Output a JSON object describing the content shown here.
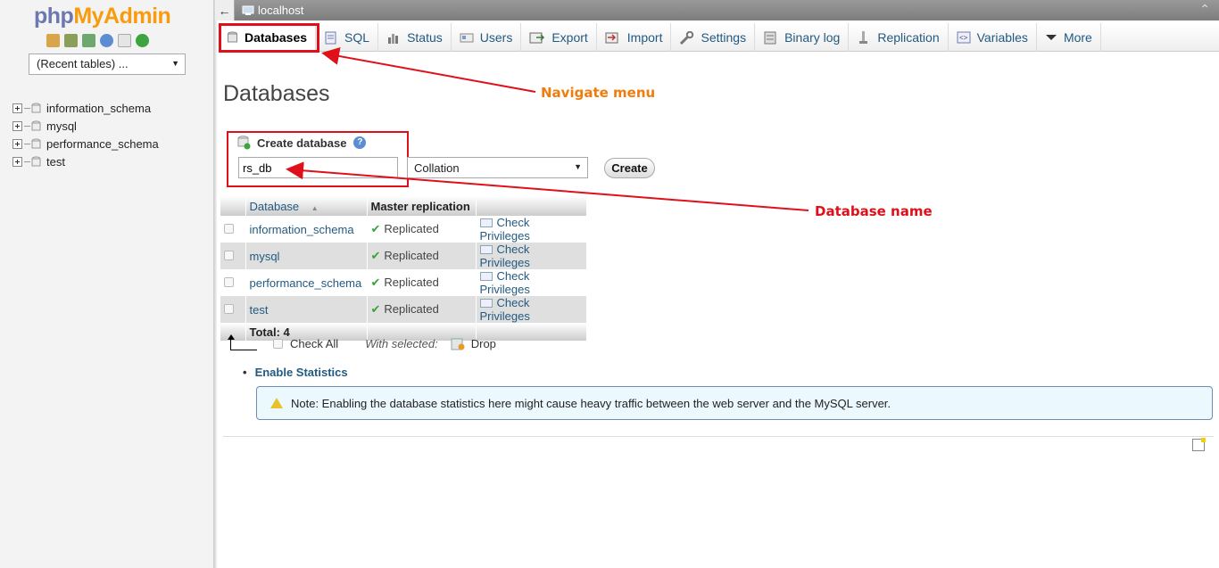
{
  "logo": {
    "php": "php",
    "myadmin": "MyAdmin"
  },
  "sidebar": {
    "recent_tables": "(Recent tables) ...",
    "databases": [
      "information_schema",
      "mysql",
      "performance_schema",
      "test"
    ]
  },
  "serverbar": {
    "server": "localhost"
  },
  "tabs": [
    {
      "label": "Databases",
      "icon": "database-icon",
      "active": true
    },
    {
      "label": "SQL",
      "icon": "sql-icon"
    },
    {
      "label": "Status",
      "icon": "status-icon"
    },
    {
      "label": "Users",
      "icon": "users-icon"
    },
    {
      "label": "Export",
      "icon": "export-icon"
    },
    {
      "label": "Import",
      "icon": "import-icon"
    },
    {
      "label": "Settings",
      "icon": "wrench-icon"
    },
    {
      "label": "Binary log",
      "icon": "binlog-icon"
    },
    {
      "label": "Replication",
      "icon": "replication-icon"
    },
    {
      "label": "Variables",
      "icon": "variables-icon"
    },
    {
      "label": "More",
      "icon": "chevron-down-icon"
    }
  ],
  "main": {
    "title": "Databases",
    "create_label": "Create database",
    "db_name_value": "rs_db",
    "collation": "Collation",
    "create_button": "Create"
  },
  "table": {
    "headers": {
      "database": "Database",
      "replication": "Master replication"
    },
    "rows": [
      {
        "name": "information_schema",
        "replication": "Replicated",
        "privileges": "Check Privileges"
      },
      {
        "name": "mysql",
        "replication": "Replicated",
        "privileges": "Check Privileges"
      },
      {
        "name": "performance_schema",
        "replication": "Replicated",
        "privileges": "Check Privileges"
      },
      {
        "name": "test",
        "replication": "Replicated",
        "privileges": "Check Privileges"
      }
    ],
    "total": "Total: 4"
  },
  "actions": {
    "check_all": "Check All",
    "with_selected": "With selected:",
    "drop": "Drop"
  },
  "enable_stats": "Enable Statistics",
  "notice": "Note: Enabling the database statistics here might cause heavy traffic between the web server and the MySQL server.",
  "annotations": {
    "navigate": "Navigate menu",
    "dbname": "Database name"
  },
  "colors": {
    "annotation_red": "#e0101a",
    "annotation_orange": "#f07c0c",
    "link_blue": "#235a81"
  }
}
